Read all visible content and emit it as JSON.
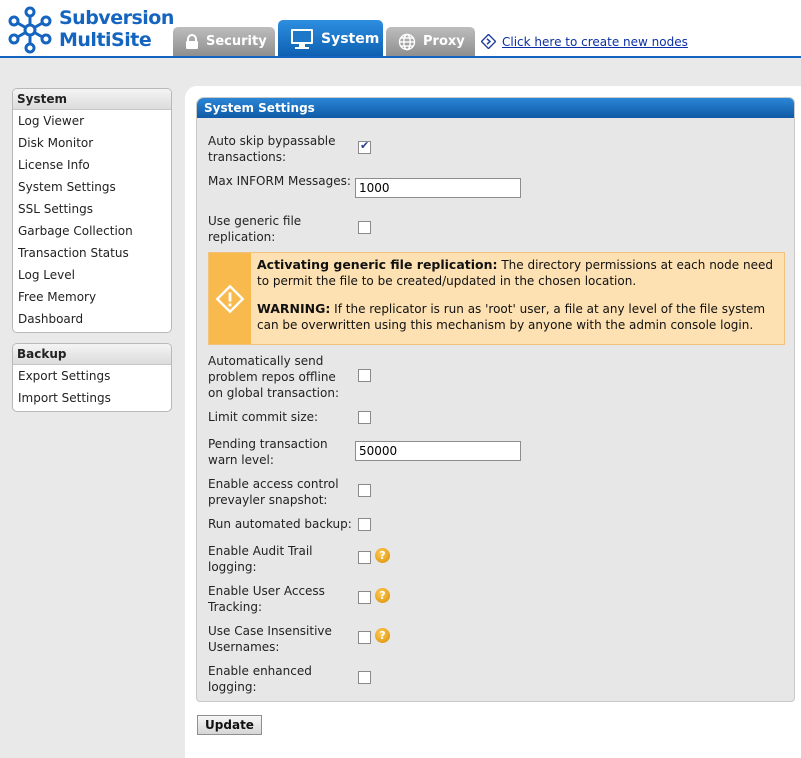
{
  "header": {
    "logo_line1": "Subversion",
    "logo_line2": "MultiSite",
    "tabs": [
      {
        "label": "Security",
        "icon": "lock-icon",
        "active": false
      },
      {
        "label": "System",
        "icon": "monitor-icon",
        "active": true
      },
      {
        "label": "Proxy",
        "icon": "globe-icon",
        "active": false
      }
    ],
    "create_nodes_link": "Click here to create new nodes"
  },
  "sidebar": {
    "system": {
      "title": "System",
      "items": [
        "Log Viewer",
        "Disk Monitor",
        "License Info",
        "System Settings",
        "SSL Settings",
        "Garbage Collection",
        "Transaction Status",
        "Log Level",
        "Free Memory",
        "Dashboard"
      ]
    },
    "backup": {
      "title": "Backup",
      "items": [
        "Export Settings",
        "Import Settings"
      ]
    }
  },
  "settings": {
    "title": "System Settings",
    "auto_skip": {
      "label": "Auto skip bypassable transactions:",
      "checked": true
    },
    "max_inform": {
      "label": "Max INFORM Messages:",
      "value": "1000"
    },
    "generic_replication": {
      "label": "Use generic file replication:",
      "checked": false
    },
    "warning": {
      "heading1": "Activating generic file replication:",
      "text1": " The directory permissions at each node need to permit the file to be created/updated in the chosen location.",
      "heading2": "WARNING:",
      "text2": " If the replicator is run as 'root' user, a file at any level of the file system can be overwritten using this mechanism by anyone with the admin console login."
    },
    "auto_offline": {
      "label": "Automatically send problem repos offline on global transaction:",
      "checked": false
    },
    "limit_commit": {
      "label": "Limit commit size:",
      "checked": false
    },
    "pending_warn": {
      "label": "Pending transaction warn level:",
      "value": "50000"
    },
    "access_snapshot": {
      "label": "Enable access control prevayler snapshot:",
      "checked": false
    },
    "auto_backup": {
      "label": "Run automated backup:",
      "checked": false
    },
    "audit_trail": {
      "label": "Enable Audit Trail logging:",
      "checked": false,
      "help": "?"
    },
    "user_tracking": {
      "label": "Enable User Access Tracking:",
      "checked": false,
      "help": "?"
    },
    "case_insensitive": {
      "label": "Use Case Insensitive Usernames:",
      "checked": false,
      "help": "?"
    },
    "enhanced_logging": {
      "label": "Enable enhanced logging:",
      "checked": false
    }
  },
  "update_button": "Update",
  "colors": {
    "brand": "#1565c0",
    "warning_bg": "#fde1b3",
    "warning_side": "#f8ba4d"
  }
}
